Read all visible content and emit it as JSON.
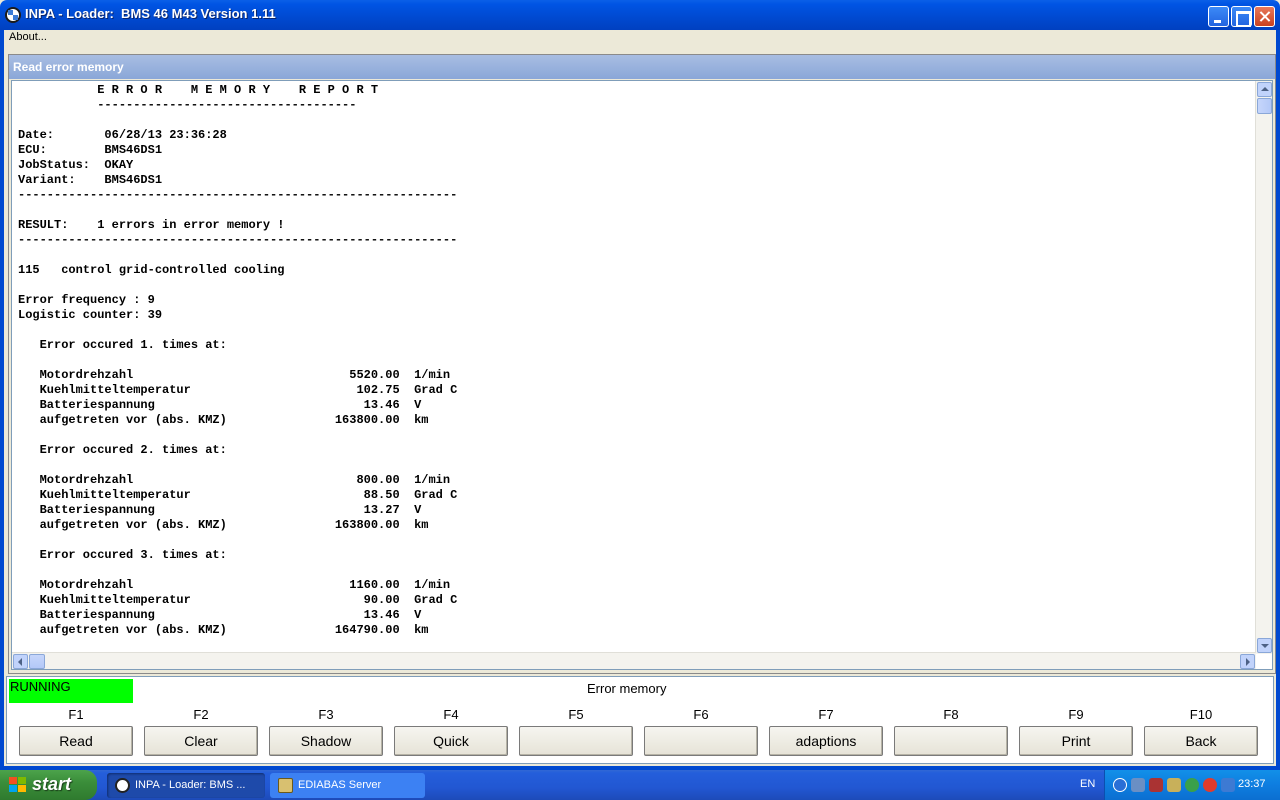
{
  "window": {
    "title": "INPA - Loader:  BMS 46 M43 Version 1.11"
  },
  "menu": {
    "about": "About..."
  },
  "child_window": {
    "title": "Read error memory"
  },
  "report": {
    "lines": [
      "           E R R O R    M E M O R Y    R E P O R T",
      "           ------------------------------------",
      "",
      "Date:       06/28/13 23:36:28",
      "ECU:        BMS46DS1",
      "JobStatus:  OKAY",
      "Variant:    BMS46DS1",
      "-------------------------------------------------------------",
      "",
      "RESULT:    1 errors in error memory !",
      "-------------------------------------------------------------",
      "",
      "115   control grid-controlled cooling",
      "",
      "Error frequency : 9",
      "Logistic counter: 39",
      "",
      "   Error occured 1. times at:",
      "",
      "   Motordrehzahl                              5520.00  1/min",
      "   Kuehlmitteltemperatur                       102.75  Grad C",
      "   Batteriespannung                             13.46  V",
      "   aufgetreten vor (abs. KMZ)               163800.00  km",
      "",
      "   Error occured 2. times at:",
      "",
      "   Motordrehzahl                               800.00  1/min",
      "   Kuehlmitteltemperatur                        88.50  Grad C",
      "   Batteriespannung                             13.27  V",
      "   aufgetreten vor (abs. KMZ)               163800.00  km",
      "",
      "   Error occured 3. times at:",
      "",
      "   Motordrehzahl                              1160.00  1/min",
      "   Kuehlmitteltemperatur                        90.00  Grad C",
      "   Batteriespannung                             13.46  V",
      "   aufgetreten vor (abs. KMZ)               164790.00  km"
    ]
  },
  "status": {
    "running": "RUNNING",
    "title": "Error memory",
    "running_color": "#00ff00"
  },
  "fkeys": [
    {
      "key": "F1",
      "label": "Read"
    },
    {
      "key": "F2",
      "label": "Clear"
    },
    {
      "key": "F3",
      "label": "Shadow"
    },
    {
      "key": "F4",
      "label": "Quick"
    },
    {
      "key": "F5",
      "label": ""
    },
    {
      "key": "F6",
      "label": ""
    },
    {
      "key": "F7",
      "label": "adaptions"
    },
    {
      "key": "F8",
      "label": ""
    },
    {
      "key": "F9",
      "label": "Print"
    },
    {
      "key": "F10",
      "label": "Back"
    }
  ],
  "taskbar": {
    "start": "start",
    "tasks": [
      {
        "label": "INPA - Loader:  BMS ..."
      },
      {
        "label": "EDIABAS Server"
      }
    ],
    "language": "EN",
    "clock": "23:37"
  }
}
